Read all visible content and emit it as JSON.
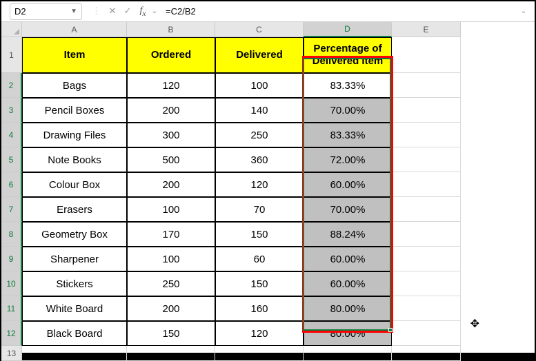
{
  "formula_bar": {
    "cell_ref": "D2",
    "formula": "=C2/B2"
  },
  "columns": [
    "A",
    "B",
    "C",
    "D",
    "E"
  ],
  "headers": {
    "A": "Item",
    "B": "Ordered",
    "C": "Delivered",
    "D": "Percentage of Delivered Item"
  },
  "rows": [
    {
      "n": "2",
      "item": "Bags",
      "ordered": "120",
      "delivered": "100",
      "pct": "83.33%"
    },
    {
      "n": "3",
      "item": "Pencil Boxes",
      "ordered": "200",
      "delivered": "140",
      "pct": "70.00%"
    },
    {
      "n": "4",
      "item": "Drawing Files",
      "ordered": "300",
      "delivered": "250",
      "pct": "83.33%"
    },
    {
      "n": "5",
      "item": "Note Books",
      "ordered": "500",
      "delivered": "360",
      "pct": "72.00%"
    },
    {
      "n": "6",
      "item": "Colour Box",
      "ordered": "200",
      "delivered": "120",
      "pct": "60.00%"
    },
    {
      "n": "7",
      "item": "Erasers",
      "ordered": "100",
      "delivered": "70",
      "pct": "70.00%"
    },
    {
      "n": "8",
      "item": "Geometry Box",
      "ordered": "170",
      "delivered": "150",
      "pct": "88.24%"
    },
    {
      "n": "9",
      "item": "Sharpener",
      "ordered": "100",
      "delivered": "60",
      "pct": "60.00%"
    },
    {
      "n": "10",
      "item": "Stickers",
      "ordered": "250",
      "delivered": "150",
      "pct": "60.00%"
    },
    {
      "n": "11",
      "item": "White Board",
      "ordered": "200",
      "delivered": "160",
      "pct": "80.00%"
    },
    {
      "n": "12",
      "item": "Black Board",
      "ordered": "150",
      "delivered": "120",
      "pct": "80.00%"
    }
  ],
  "row_after": "13",
  "chart_data": {
    "type": "table",
    "columns": [
      "Item",
      "Ordered",
      "Delivered",
      "Percentage of Delivered Item"
    ],
    "data": [
      [
        "Bags",
        120,
        100,
        "83.33%"
      ],
      [
        "Pencil Boxes",
        200,
        140,
        "70.00%"
      ],
      [
        "Drawing Files",
        300,
        250,
        "83.33%"
      ],
      [
        "Note Books",
        500,
        360,
        "72.00%"
      ],
      [
        "Colour Box",
        200,
        120,
        "60.00%"
      ],
      [
        "Erasers",
        100,
        70,
        "70.00%"
      ],
      [
        "Geometry Box",
        170,
        150,
        "88.24%"
      ],
      [
        "Sharpener",
        100,
        60,
        "60.00%"
      ],
      [
        "Stickers",
        250,
        150,
        "60.00%"
      ],
      [
        "White Board",
        200,
        160,
        "80.00%"
      ],
      [
        "Black Board",
        150,
        120,
        "80.00%"
      ]
    ]
  }
}
